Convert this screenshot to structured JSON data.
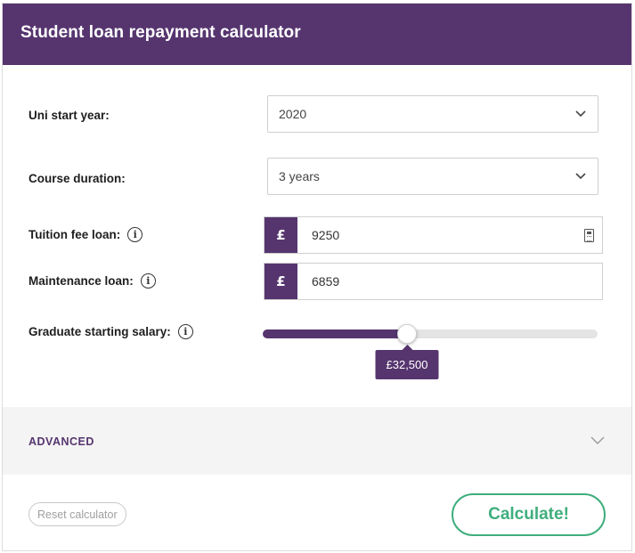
{
  "header": {
    "title": "Student loan repayment calculator"
  },
  "fields": {
    "uni_start_year": {
      "label": "Uni start year:",
      "value": "2020"
    },
    "course_duration": {
      "label": "Course duration:",
      "value": "3 years"
    },
    "tuition_fee_loan": {
      "label": "Tuition fee loan:",
      "currency": "£",
      "value": "9250"
    },
    "maintenance_loan": {
      "label": "Maintenance loan:",
      "currency": "£",
      "value": "6859"
    },
    "graduate_salary": {
      "label": "Graduate starting salary:",
      "value_text": "£32,500",
      "fraction": 0.43
    }
  },
  "advanced": {
    "label": "ADVANCED"
  },
  "buttons": {
    "reset": "Reset calculator",
    "calculate": "Calculate!"
  },
  "icons": {
    "info": "i",
    "chevron": "chevron-down-icon",
    "calculator": "calculator-icon"
  },
  "colors": {
    "brand": "#56356f",
    "accent": "#3fae7d"
  }
}
